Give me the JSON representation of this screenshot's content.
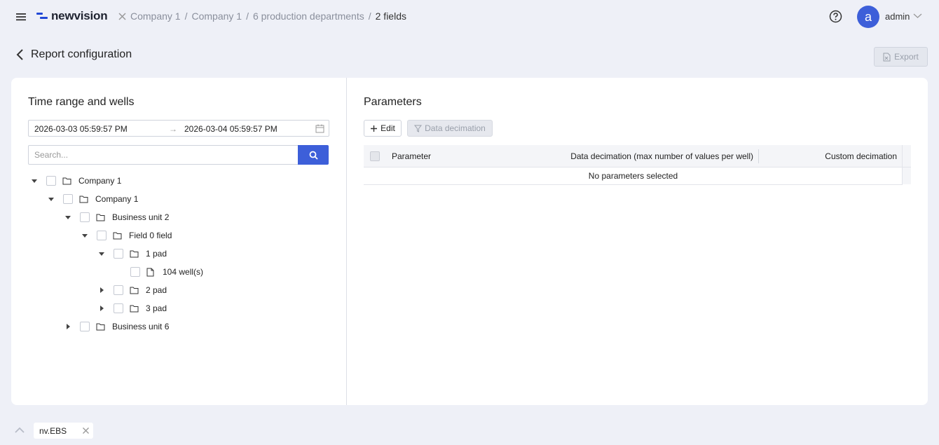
{
  "header": {
    "logo_text": "newvision",
    "breadcrumb": [
      "Company 1",
      "Company 1",
      "6 production departments",
      "2 fields"
    ],
    "user_initial": "a",
    "user_name": "admin"
  },
  "title_bar": {
    "title": "Report configuration",
    "export_label": "Export"
  },
  "left_panel": {
    "title": "Time range and wells",
    "date_start": "2026-03-03 05:59:57 PM",
    "date_arrow": "→",
    "date_end": "2026-03-04 05:59:57 PM",
    "search_placeholder": "Search...",
    "tree": [
      {
        "label": "Company 1",
        "level": 0,
        "state": "expanded",
        "icon": "folder-icon"
      },
      {
        "label": "Company 1",
        "level": 1,
        "state": "expanded",
        "icon": "folder-icon"
      },
      {
        "label": "Business unit 2",
        "level": 2,
        "state": "expanded",
        "icon": "folder-icon"
      },
      {
        "label": "Field 0 field",
        "level": 3,
        "state": "expanded",
        "icon": "folder-icon"
      },
      {
        "label": "1 pad",
        "level": 4,
        "state": "expanded",
        "icon": "folder-icon"
      },
      {
        "label": "104 well(s)",
        "level": 5,
        "state": "leaf",
        "icon": "file-icon"
      },
      {
        "label": "2 pad",
        "level": 4,
        "state": "collapsed",
        "icon": "folder-icon"
      },
      {
        "label": "3 pad",
        "level": 4,
        "state": "collapsed",
        "icon": "folder-icon"
      },
      {
        "label": "Business unit 6",
        "level": 2,
        "state": "collapsed",
        "icon": "folder-icon"
      }
    ]
  },
  "right_panel": {
    "title": "Parameters",
    "edit_label": "Edit",
    "decimation_label": "Data decimation",
    "columns": [
      "Parameter",
      "Data decimation (max number of values per well)",
      "Custom decimation"
    ],
    "empty_text": "No parameters selected"
  },
  "bottom_bar": {
    "tab_label": "nv.EBS"
  },
  "colors": {
    "accent": "#3d5fd9",
    "background": "#eef0f7"
  }
}
